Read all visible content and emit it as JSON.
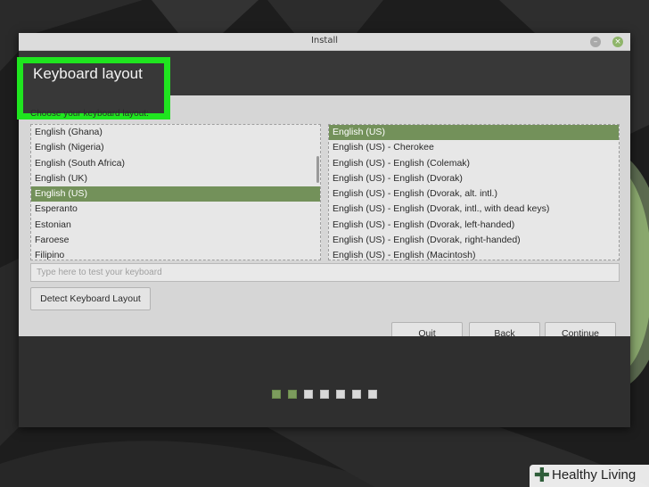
{
  "window": {
    "title": "Install",
    "minimize_glyph": "–",
    "close_glyph": "×"
  },
  "header": {
    "title": "Keyboard layout"
  },
  "content": {
    "prompt": "Choose your keyboard layout:",
    "layouts": [
      {
        "label": "English (Ghana)",
        "selected": false
      },
      {
        "label": "English (Nigeria)",
        "selected": false
      },
      {
        "label": "English (South Africa)",
        "selected": false
      },
      {
        "label": "English (UK)",
        "selected": false
      },
      {
        "label": "English (US)",
        "selected": true
      },
      {
        "label": "Esperanto",
        "selected": false
      },
      {
        "label": "Estonian",
        "selected": false
      },
      {
        "label": "Faroese",
        "selected": false
      },
      {
        "label": "Filipino",
        "selected": false
      }
    ],
    "variants": [
      {
        "label": "English (US)",
        "selected": true
      },
      {
        "label": "English (US) - Cherokee",
        "selected": false
      },
      {
        "label": "English (US) - English (Colemak)",
        "selected": false
      },
      {
        "label": "English (US) - English (Dvorak)",
        "selected": false
      },
      {
        "label": "English (US) - English (Dvorak, alt. intl.)",
        "selected": false
      },
      {
        "label": "English (US) - English (Dvorak, intl., with dead keys)",
        "selected": false
      },
      {
        "label": "English (US) - English (Dvorak, left-handed)",
        "selected": false
      },
      {
        "label": "English (US) - English (Dvorak, right-handed)",
        "selected": false
      },
      {
        "label": "English (US) - English (Macintosh)",
        "selected": false
      }
    ],
    "test_placeholder": "Type here to test your keyboard",
    "detect_label": "Detect Keyboard Layout"
  },
  "nav": {
    "quit_label": "Quit",
    "back_label": "Back",
    "continue_label": "Continue"
  },
  "progress": {
    "total_steps": 7,
    "completed_steps": 2
  },
  "watermark": {
    "text": "Healthy Living",
    "icon": "plus-icon"
  },
  "colors": {
    "selection": "#73915a",
    "header_bg": "#383838",
    "highlight_box": "#1fe51f",
    "footer_bg": "#2f2f2f"
  }
}
